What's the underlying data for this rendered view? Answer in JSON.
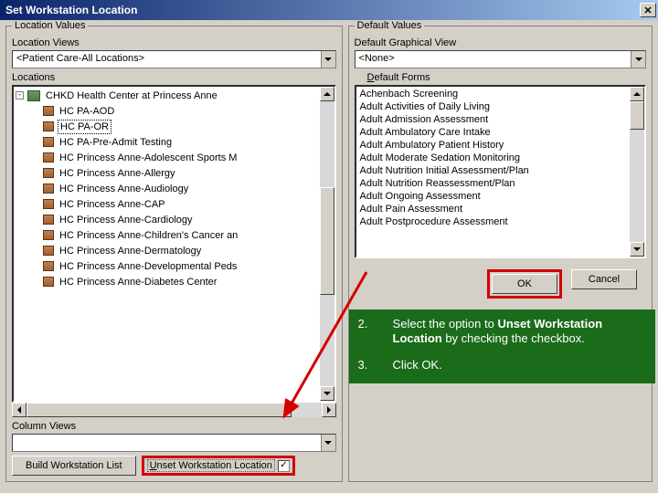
{
  "title": "Set Workstation Location",
  "left": {
    "legend": "Location Values",
    "location_views_label": "Location Views",
    "location_views_value": "<Patient Care-All Locations>",
    "locations_label": "Locations",
    "tree_root": "CHKD Health Center at Princess Anne",
    "tree_children": [
      "HC PA-AOD",
      "HC PA-OR",
      "HC PA-Pre-Admit Testing",
      "HC Princess Anne-Adolescent Sports M",
      "HC Princess Anne-Allergy",
      "HC Princess Anne-Audiology",
      "HC Princess Anne-CAP",
      "HC Princess Anne-Cardiology",
      "HC Princess Anne-Children's Cancer an",
      "HC Princess Anne-Dermatology",
      "HC Princess Anne-Developmental Peds",
      "HC Princess Anne-Diabetes Center"
    ],
    "selected_child_index": 1,
    "column_views_label": "Column Views",
    "build_label": "Build Workstation List",
    "unset_label": "Unset Workstation Location",
    "checked": true
  },
  "right": {
    "legend": "Default Values",
    "graphical_view_label": "Default Graphical View",
    "graphical_view_value": "<None>",
    "default_forms_label": "Default Forms",
    "forms": [
      "Achenbach Screening",
      "Adult Activities of Daily Living",
      "Adult Admission Assessment",
      "Adult Ambulatory Care Intake",
      "Adult Ambulatory Patient History",
      "Adult Moderate Sedation Monitoring",
      "Adult Nutrition Initial Assessment/Plan",
      "Adult Nutrition Reassessment/Plan",
      "Adult Ongoing Assessment",
      "Adult Pain Assessment",
      "Adult Postprocedure Assessment"
    ],
    "ok_label": "OK",
    "cancel_label": "Cancel"
  },
  "callout": {
    "step2_num": "2.",
    "step2_pre": "Select the option to ",
    "step2_bold": "Unset Workstation Location",
    "step2_post": " by checking the checkbox.",
    "step3_num": "3.",
    "step3_text": "Click OK."
  }
}
